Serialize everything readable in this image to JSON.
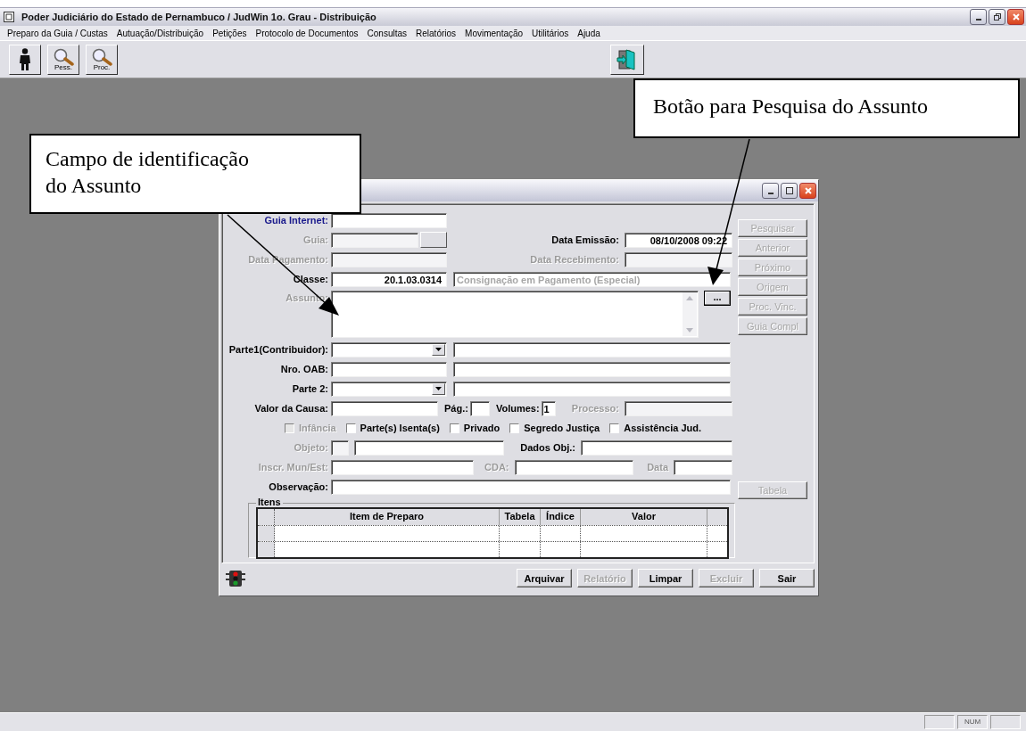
{
  "window": {
    "title": "Poder Judiciário do Estado de Pernambuco / JudWin 1o. Grau - Distribuição"
  },
  "menu": [
    "Preparo da Guia / Custas",
    "Autuação/Distribuição",
    "Petições",
    "Protocolo de Documentos",
    "Consultas",
    "Relatórios",
    "Movimentação",
    "Utilitários",
    "Ajuda"
  ],
  "toolbar": [
    {
      "kind": "person"
    },
    {
      "kind": "search",
      "label": "Pess."
    },
    {
      "kind": "search",
      "label": "Proc."
    }
  ],
  "form": {
    "guia_internet": {
      "label": "Guia Internet:"
    },
    "guia": {
      "label": "Guia:",
      "disabled": true
    },
    "data_emissao": {
      "label": "Data Emissão:",
      "value": "08/10/2008 09:22",
      "disabled": false
    },
    "data_pagamento": {
      "label": "Data Pagamento:",
      "disabled": true
    },
    "data_recebimento": {
      "label": "Data Recebimento:",
      "disabled": true
    },
    "classe": {
      "label": "Classe:",
      "code": "20.1.03.0314",
      "description": "Consignação em Pagamento (Especial)",
      "disabled": false
    },
    "assunto": {
      "label": "Assunto:",
      "disabled": true
    },
    "lookup_button": {
      "label": "..."
    },
    "parte1": {
      "label": "Parte1(Contribuidor):",
      "disabled": false
    },
    "nro_oab": {
      "label": "Nro. OAB:",
      "disabled": false
    },
    "parte2": {
      "label": "Parte 2:",
      "disabled": false
    },
    "valor_causa": {
      "label": "Valor da Causa:",
      "disabled": false
    },
    "pag": {
      "label": "Pág.:",
      "disabled": false
    },
    "volumes": {
      "label": "Volumes:",
      "value": "1",
      "disabled": false
    },
    "processo": {
      "label": "Processo:",
      "disabled": true
    },
    "checkboxes": [
      {
        "label": "Infância",
        "checked": false,
        "disabled": true
      },
      {
        "label": "Parte(s) Isenta(s)",
        "checked": false,
        "disabled": false
      },
      {
        "label": "Privado",
        "checked": false,
        "disabled": false
      },
      {
        "label": "Segredo Justiça",
        "checked": false,
        "disabled": false
      },
      {
        "label": "Assistência Jud.",
        "checked": false,
        "disabled": false
      }
    ],
    "objeto": {
      "label": "Objeto:",
      "disabled": true
    },
    "dados_obj": {
      "label": "Dados Obj.:",
      "disabled": false
    },
    "inscr": {
      "label": "Inscr. Mun/Est:",
      "disabled": true
    },
    "cda": {
      "label": "CDA:",
      "disabled": true
    },
    "data": {
      "label": "Data",
      "disabled": true
    },
    "observacao": {
      "label": "Observação:",
      "disabled": false
    },
    "side_buttons": [
      {
        "label": "Pesquisar",
        "disabled": true
      },
      {
        "label": "Anterior",
        "disabled": true
      },
      {
        "label": "Próximo",
        "disabled": true
      },
      {
        "label": "Origem",
        "disabled": true
      },
      {
        "label": "Proc. Vinc.",
        "disabled": true
      },
      {
        "label": "Guia Compl",
        "disabled": true
      }
    ],
    "tabela_button": {
      "label": "Tabela",
      "disabled": true
    },
    "itens": {
      "title": "Itens",
      "columns": [
        "Item de Preparo",
        "Tabela",
        "Índice",
        "Valor"
      ]
    },
    "bottom_buttons": [
      {
        "label": "Arquivar",
        "disabled": false
      },
      {
        "label": "Relatório",
        "disabled": true
      },
      {
        "label": "Limpar",
        "disabled": false
      },
      {
        "label": "Excluir",
        "disabled": true
      },
      {
        "label": "Sair",
        "disabled": false
      }
    ]
  },
  "callouts": [
    {
      "text": "Campo de identificação do Assunto"
    },
    {
      "text": "Botão para Pesquisa do Assunto"
    }
  ],
  "status_bar": {
    "indicator": "NUM"
  }
}
